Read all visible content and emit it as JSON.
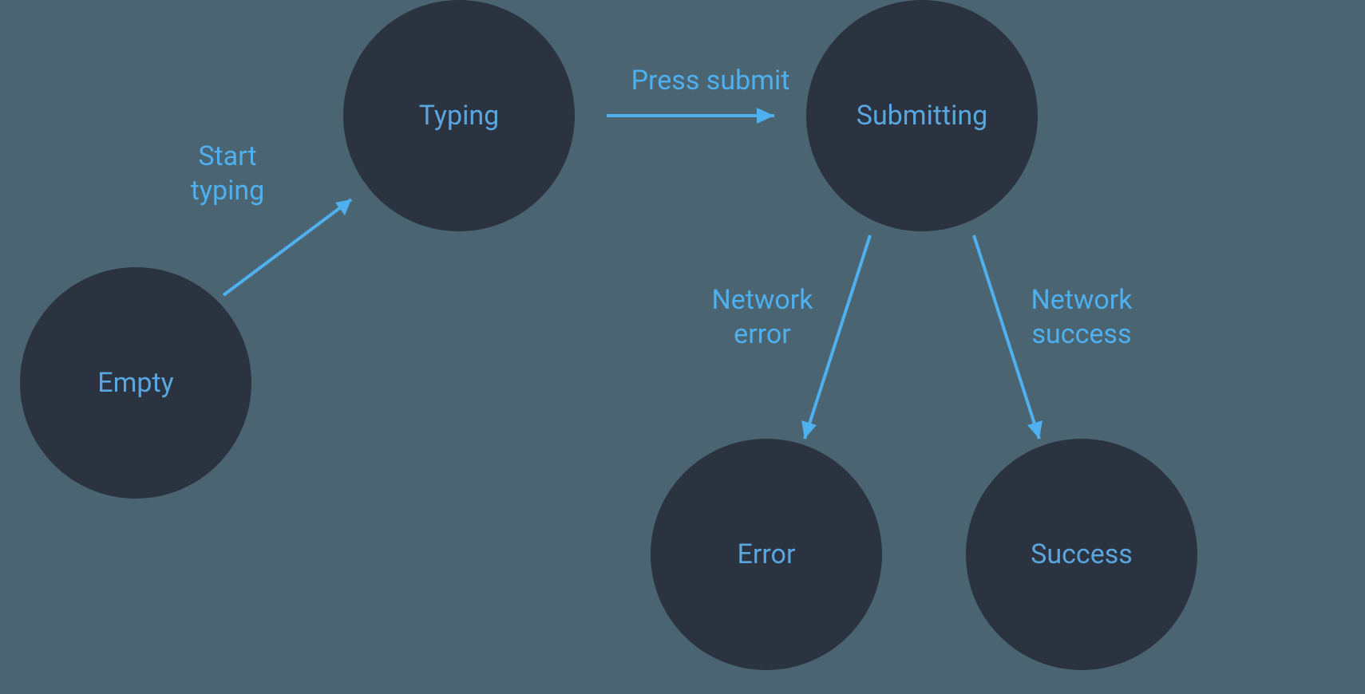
{
  "states": {
    "empty": "Empty",
    "typing": "Typing",
    "submitting": "Submitting",
    "error": "Error",
    "success": "Success"
  },
  "transitions": {
    "start_typing": {
      "label_line1": "Start",
      "label_line2": "typing",
      "from": "empty",
      "to": "typing"
    },
    "press_submit": {
      "label": "Press submit",
      "from": "typing",
      "to": "submitting"
    },
    "network_error": {
      "label_line1": "Network",
      "label_line2": "error",
      "from": "submitting",
      "to": "error"
    },
    "network_success": {
      "label_line1": "Network",
      "label_line2": "success",
      "from": "submitting",
      "to": "success"
    }
  },
  "colors": {
    "background": "#4a6471",
    "node_fill": "#2b3240",
    "text": "#5aa7e0",
    "arrow": "#4fb0f0"
  }
}
